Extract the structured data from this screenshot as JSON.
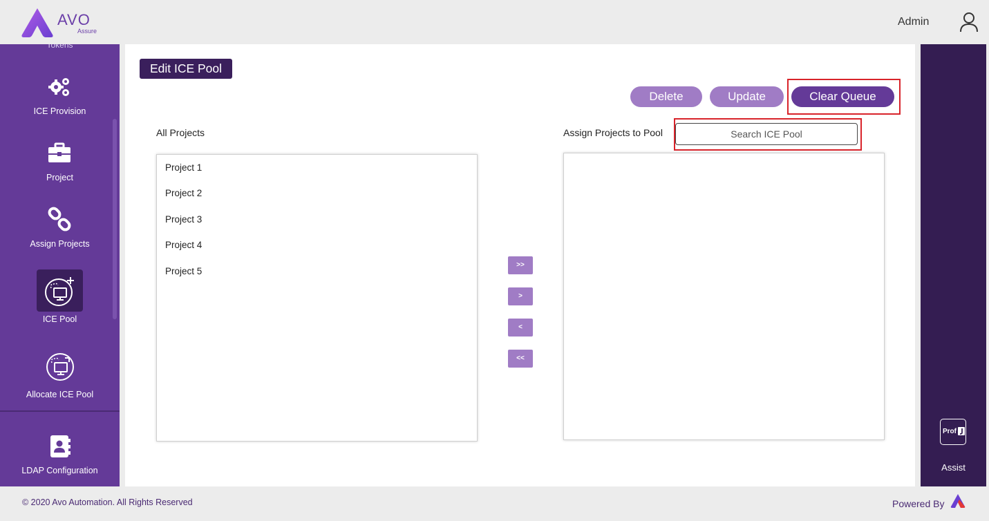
{
  "header": {
    "logo_text": "AVO",
    "logo_sub": "Assure",
    "user_name": "Admin"
  },
  "sidebar": {
    "partial_item": "Tokens",
    "items": [
      {
        "label": "ICE Provision",
        "icon": "gears-icon"
      },
      {
        "label": "Project",
        "icon": "briefcase-icon"
      },
      {
        "label": "Assign Projects",
        "icon": "link-icon"
      },
      {
        "label": "ICE Pool",
        "icon": "ice-pool-icon",
        "active": true
      },
      {
        "label": "Allocate ICE Pool",
        "icon": "allocate-ice-pool-icon"
      },
      {
        "label": "LDAP Configuration",
        "icon": "contact-book-icon"
      }
    ]
  },
  "main": {
    "title": "Edit ICE Pool",
    "buttons": {
      "delete": "Delete",
      "update": "Update",
      "clear_queue": "Clear Queue"
    },
    "all_projects_label": "All Projects",
    "assign_label": "Assign Projects to Pool",
    "search_placeholder": "Search ICE Pool",
    "projects": [
      "Project 1",
      "Project 2",
      "Project 3",
      "Project 4",
      "Project 5"
    ],
    "assigned_projects": [],
    "move_buttons": {
      "move_all_right": ">>",
      "move_right": ">",
      "move_left": "<",
      "move_all_left": "<<"
    }
  },
  "assist": {
    "icon_text": "Prof",
    "label": "Assist"
  },
  "footer": {
    "copyright": "© 2020 Avo Automation. All Rights Reserved",
    "powered_by": "Powered By"
  },
  "colors": {
    "sidebar_bg": "#643a98",
    "dark_purple": "#3a1f5c",
    "light_purple": "#a07cc5",
    "highlight_red": "#d8232a"
  }
}
